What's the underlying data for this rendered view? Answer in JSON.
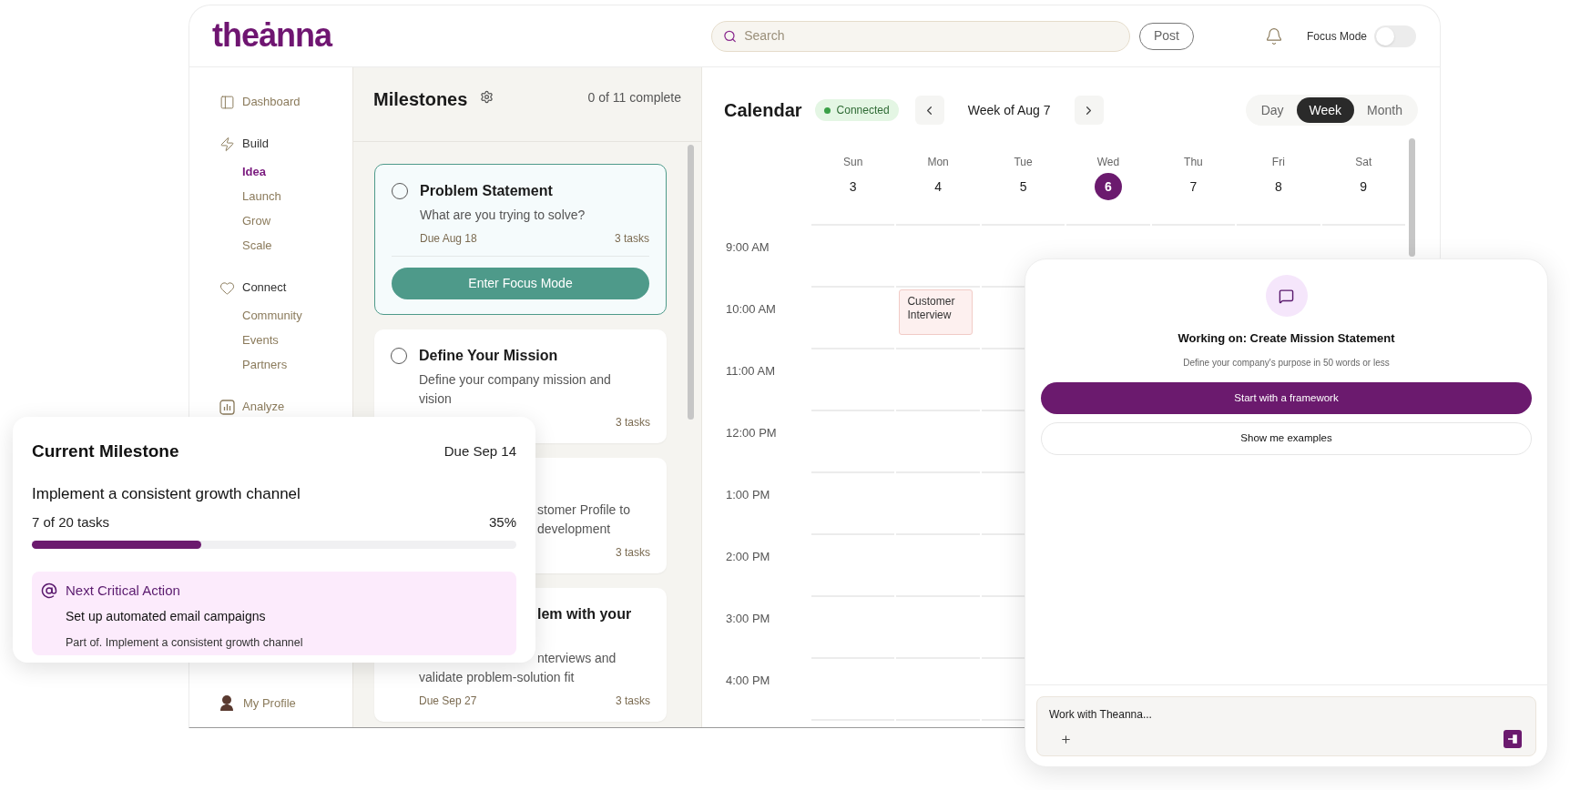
{
  "header": {
    "logo": "theȧnna",
    "search": {
      "placeholder": "Search"
    },
    "post_button": "Post",
    "focus_mode": {
      "label": "Focus Mode",
      "on": false
    }
  },
  "sidebar": {
    "sections": [
      {
        "label": "Dashboard",
        "selected": false
      },
      {
        "label": "Build",
        "selected": false,
        "children": [
          {
            "label": "Idea",
            "selected": true
          },
          {
            "label": "Launch",
            "selected": false
          },
          {
            "label": "Grow",
            "selected": false
          },
          {
            "label": "Scale",
            "selected": false
          }
        ]
      },
      {
        "label": "Connect",
        "selected": false,
        "children": [
          {
            "label": "Community",
            "selected": false
          },
          {
            "label": "Events",
            "selected": false
          },
          {
            "label": "Partners",
            "selected": false
          }
        ]
      },
      {
        "label": "Analyze",
        "selected": false
      }
    ],
    "profile": "My Profile"
  },
  "milestones": {
    "title": "Milestones",
    "count": "0 of 11 complete",
    "cards": [
      {
        "selected": true,
        "title_lines": [
          {
            "text": "Problem Statement",
            "kind": "full"
          }
        ],
        "description_lines": [
          {
            "text": "What are you trying to solve?",
            "kind": "full"
          }
        ],
        "due": "Due Aug 18",
        "tasks": "3 tasks",
        "action": "Enter Focus Mode"
      },
      {
        "selected": false,
        "title_lines": [
          {
            "text": "Define Your Mission",
            "kind": "full"
          }
        ],
        "description_lines": [
          {
            "text": "Define your company mission and",
            "kind": "full"
          },
          {
            "text": "vision",
            "kind": "full"
          }
        ],
        "tasks": "3 tasks"
      },
      {
        "selected": false,
        "description_lines": [
          {
            "text": "stomer Profile to",
            "kind": "partial"
          },
          {
            "text": "development",
            "kind": "partial"
          }
        ],
        "tasks": "3 tasks"
      },
      {
        "selected": false,
        "title_lines": [
          {
            "text": "lem with your",
            "kind": "partial"
          }
        ],
        "description_lines": [
          {
            "text": "nterviews and",
            "kind": "partial"
          },
          {
            "text": "validate problem-solution fit",
            "kind": "full"
          }
        ],
        "due": "Due Sep 27",
        "tasks": "3 tasks"
      }
    ]
  },
  "calendar": {
    "title": "Calendar",
    "status": "Connected",
    "week": "Week of Aug 7",
    "views": [
      {
        "label": "Day",
        "selected": false
      },
      {
        "label": "Week",
        "selected": true
      },
      {
        "label": "Month",
        "selected": false
      }
    ],
    "days": [
      {
        "name": "Sun",
        "date": "3",
        "selected": false
      },
      {
        "name": "Mon",
        "date": "4",
        "selected": false
      },
      {
        "name": "Tue",
        "date": "5",
        "selected": false
      },
      {
        "name": "Wed",
        "date": "6",
        "selected": true
      },
      {
        "name": "Thu",
        "date": "7",
        "selected": false
      },
      {
        "name": "Fri",
        "date": "8",
        "selected": false
      },
      {
        "name": "Sat",
        "date": "9",
        "selected": false
      }
    ],
    "rows": [
      {
        "time": "9:00 AM"
      },
      {
        "time": "10:00 AM",
        "cells": [
          {},
          {
            "event": "Customer Interview"
          },
          {},
          {},
          {},
          {},
          {}
        ]
      },
      {
        "time": "11:00 AM"
      },
      {
        "time": "12:00 PM"
      },
      {
        "time": "1:00 PM"
      },
      {
        "time": "2:00 PM"
      },
      {
        "time": "3:00 PM"
      },
      {
        "time": "4:00 PM"
      }
    ]
  },
  "current_milestone": {
    "title": "Current Milestone",
    "due": "Due Sep 14",
    "name": "Implement a consistent growth channel",
    "progress_text": "7 of 20 tasks",
    "percent": "35%",
    "level": 0.35,
    "next_action": {
      "heading": "Next Critical Action",
      "task": "Set up automated email campaigns",
      "part_of": "Part of. Implement a consistent growth channel"
    }
  },
  "assistant": {
    "title": "Working on: Create Mission Statement",
    "subtitle": "Define your company's purpose in 50 words or less",
    "primary_button": "Start with a framework",
    "secondary_button": "Show me examples",
    "input": {
      "placeholder": "Work with Theanna..."
    }
  }
}
